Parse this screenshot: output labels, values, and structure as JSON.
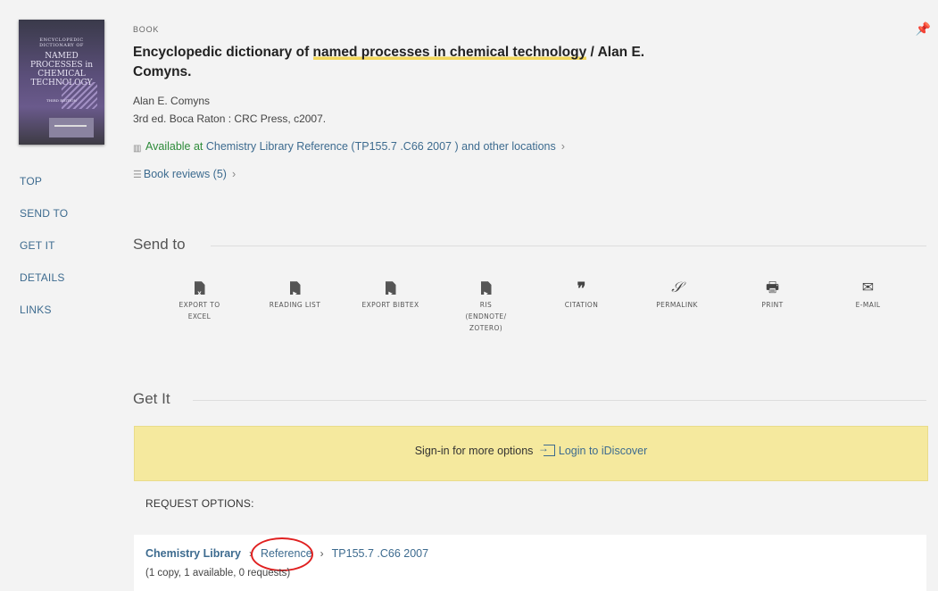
{
  "record": {
    "type_label": "BOOK",
    "title_pre": "Encyclopedic dictionary of ",
    "title_highlight": "named processes in chemical technology",
    "title_post": " / Alan E. Comyns.",
    "author": "Alan E. Comyns",
    "edition": "3rd ed. Boca Raton : CRC Press, c2007.",
    "availability_status": "Available at",
    "availability_location": " Chemistry Library  Reference (TP155.7 .C66 2007 ) and other locations",
    "reviews_label": "Book reviews (5)"
  },
  "cover": {
    "line1": "ENCYCLOPEDIC DICTIONARY OF",
    "line2": "NAMED PROCESSES in CHEMICAL TECHNOLOGY",
    "line3": "THIRD EDITION"
  },
  "left_nav": [
    "TOP",
    "SEND TO",
    "GET IT",
    "DETAILS",
    "LINKS"
  ],
  "send_to": {
    "heading": "Send to",
    "actions": [
      {
        "icon": "excel-icon",
        "label1": "EXPORT TO",
        "label2": "EXCEL",
        "label3": ""
      },
      {
        "icon": "reading-list-icon",
        "label1": "READING LIST",
        "label2": "",
        "label3": ""
      },
      {
        "icon": "bibtex-icon",
        "label1": "EXPORT BIBTEX",
        "label2": "",
        "label3": ""
      },
      {
        "icon": "ris-icon",
        "label1": "RIS",
        "label2": "(ENDNOTE/",
        "label3": "ZOTERO)"
      },
      {
        "icon": "citation-icon",
        "label1": "CITATION",
        "label2": "",
        "label3": ""
      },
      {
        "icon": "permalink-icon",
        "label1": "PERMALINK",
        "label2": "",
        "label3": ""
      },
      {
        "icon": "print-icon",
        "label1": "PRINT",
        "label2": "",
        "label3": ""
      },
      {
        "icon": "email-icon",
        "label1": "E-MAIL",
        "label2": "",
        "label3": ""
      }
    ]
  },
  "get_it": {
    "heading": "Get It",
    "signin_text": "Sign-in for more options",
    "login_label": "Login to iDiscover",
    "request_options_label": "REQUEST OPTIONS:",
    "holding": {
      "library": "Chemistry Library",
      "location": "Reference",
      "call_number": "TP155.7 .C66 2007",
      "summary": "(1 copy, 1 available, 0 requests)"
    }
  },
  "colors": {
    "link": "#3d6b8f",
    "available": "#2e8b3a",
    "signin_bg": "#f5e99e",
    "highlight": "#f3d85b",
    "annotation_ring": "#e02020"
  }
}
